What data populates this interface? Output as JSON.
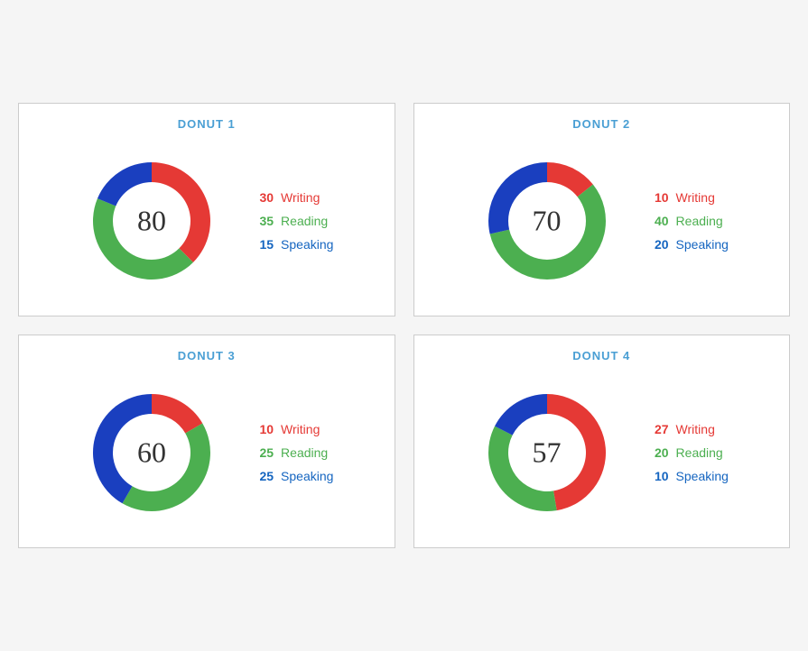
{
  "donuts": [
    {
      "id": "donut1",
      "title": "DONUT 1",
      "center": "80",
      "writing": 30,
      "reading": 35,
      "speaking": 15,
      "total": 80
    },
    {
      "id": "donut2",
      "title": "DONUT 2",
      "center": "70",
      "writing": 10,
      "reading": 40,
      "speaking": 20,
      "total": 70
    },
    {
      "id": "donut3",
      "title": "DONUT 3",
      "center": "60",
      "writing": 10,
      "reading": 25,
      "speaking": 25,
      "total": 60
    },
    {
      "id": "donut4",
      "title": "DONUT 4",
      "center": "57",
      "writing": 27,
      "reading": 20,
      "speaking": 10,
      "total": 57
    }
  ],
  "labels": {
    "writing": "Writing",
    "reading": "Reading",
    "speaking": "Speaking"
  }
}
